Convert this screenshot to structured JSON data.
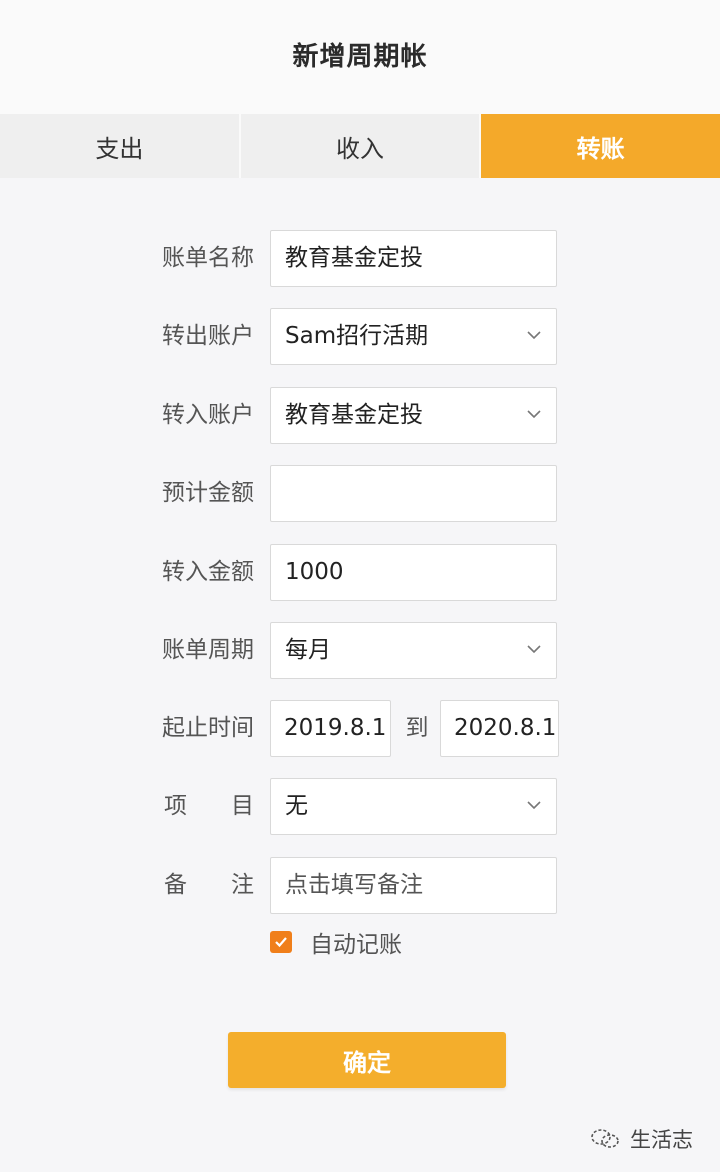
{
  "title": "新增周期帐",
  "tabs": [
    {
      "label": "支出",
      "active": false
    },
    {
      "label": "收入",
      "active": false
    },
    {
      "label": "转账",
      "active": true
    }
  ],
  "form": {
    "bill_name": {
      "label": "账单名称",
      "value": "教育基金定投"
    },
    "from_account": {
      "label": "转出账户",
      "value": "Sam招行活期"
    },
    "to_account": {
      "label": "转入账户",
      "value": "教育基金定投"
    },
    "estimated_amount": {
      "label": "预计金额",
      "value": ""
    },
    "transfer_amount": {
      "label": "转入金额",
      "value": "1000"
    },
    "bill_cycle": {
      "label": "账单周期",
      "value": "每月"
    },
    "period": {
      "label": "起止时间",
      "start": "2019.8.1",
      "to": "到",
      "end": "2020.8.1"
    },
    "project": {
      "label_chars": [
        "项",
        "目"
      ],
      "value": "无"
    },
    "note": {
      "label_chars": [
        "备",
        "注"
      ],
      "placeholder": "点击填写备注"
    }
  },
  "auto_record": {
    "label": "自动记账",
    "checked": true
  },
  "confirm_label": "确定",
  "watermark": "生活志",
  "colors": {
    "accent": "#f4a92a",
    "checkbox": "#f07f1a",
    "background": "#f6f6f8"
  }
}
